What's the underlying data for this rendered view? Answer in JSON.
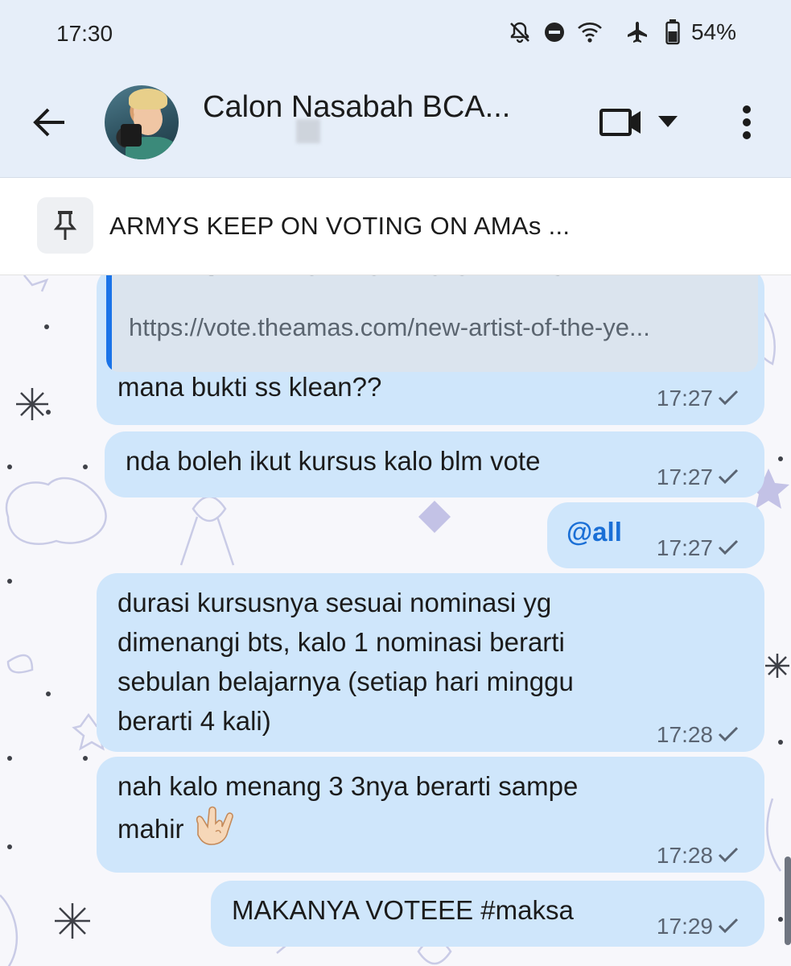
{
  "status_bar": {
    "time": "17:30",
    "battery": "54%",
    "icons": [
      "bell-off-icon",
      "do-not-disturb-icon",
      "wifi-icon",
      "airplane-icon",
      "battery-icon"
    ]
  },
  "header": {
    "title": "Calon Nasabah BCA...",
    "back_icon": "back-arrow-icon",
    "video_icon": "video-call-icon",
    "dropdown_icon": "caret-down-icon",
    "more_icon": "more-vert-icon"
  },
  "pinned": {
    "icon": "pin-icon",
    "text": "ARMYS KEEP ON VOTING ON AMAs ..."
  },
  "messages": [
    {
      "quote_title": "ARMYS KEEP ON VOTING ON AMAs",
      "quote_link": "https://vote.theamas.com/new-artist-of-the-ye...",
      "text": "mana bukti ss klean??",
      "time": "17:27"
    },
    {
      "text": "nda boleh ikut kursus kalo blm vote",
      "time": "17:27"
    },
    {
      "text": "@all",
      "time": "17:27"
    },
    {
      "lines": [
        "durasi kursusnya sesuai nominasi yg",
        "dimenangi bts, kalo 1 nominasi berarti",
        "sebulan belajarnya (setiap hari minggu",
        "berarti 4 kali)"
      ],
      "time": "17:28"
    },
    {
      "lines": [
        "nah kalo menang 3 3nya berarti sampe",
        "mahir"
      ],
      "emoji": "love-you-gesture-emoji",
      "time": "17:28"
    },
    {
      "text": "MAKANYA VOTEEE #maksa",
      "time": "17:29"
    }
  ],
  "colors": {
    "header_bg": "#e6eef9",
    "bubble_bg": "#cfe6fb",
    "accent": "#1a73e8",
    "mention": "#1a6fd6"
  }
}
